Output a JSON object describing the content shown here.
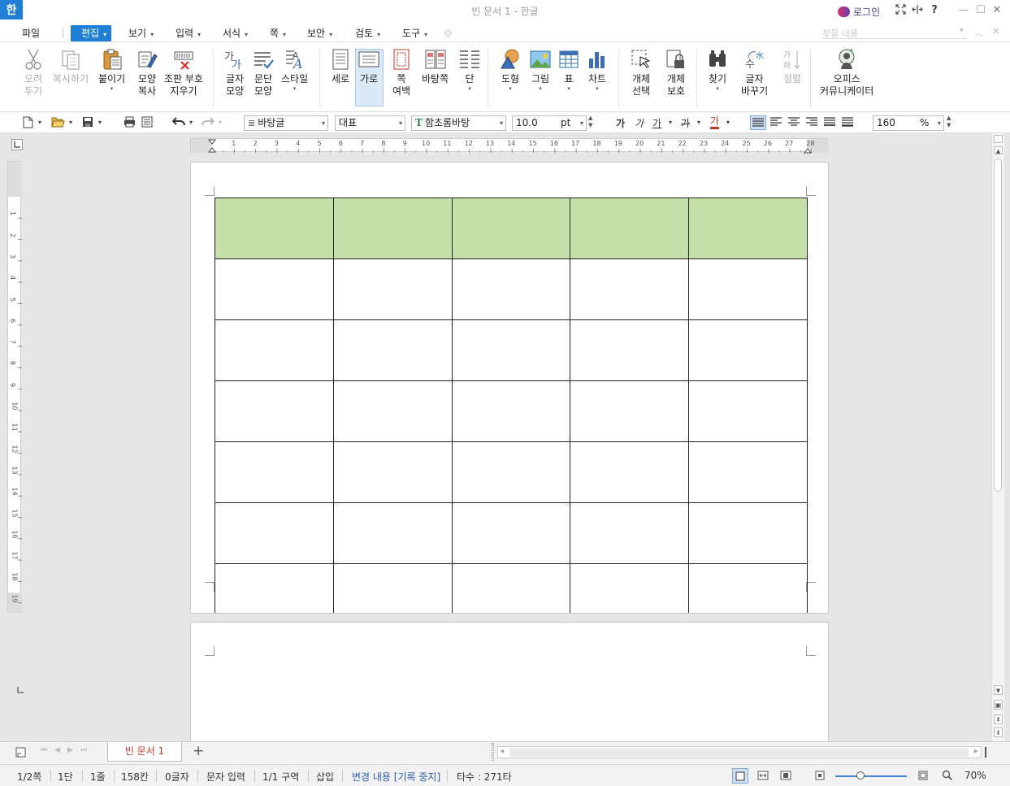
{
  "window": {
    "app_icon": "한",
    "title": "빈 문서 1 - 한글",
    "login_label": "로그인",
    "controls": [
      "fullscreen-icon",
      "split-icon",
      "help-icon",
      "minimize-icon",
      "maximize-icon",
      "close-icon"
    ],
    "help_glyph": "?",
    "minimize_glyph": "—",
    "maximize_glyph": "☐",
    "close_glyph": "✕"
  },
  "menu": {
    "items": [
      "파일",
      "편집",
      "보기",
      "입력",
      "서식",
      "쪽",
      "보안",
      "검토",
      "도구"
    ],
    "active": "편집",
    "search_placeholder": "찾을 내용"
  },
  "ribbon": {
    "cut": "오려\n두기",
    "copy": "복사하기",
    "paste": "붙이기",
    "format_copy": "모양\n복사",
    "clear_marks": "조판 부호\n지우기",
    "char_shape": "글자\n모양",
    "para_shape": "문단\n모양",
    "style": "스타일",
    "portrait": "세로",
    "landscape": "가로",
    "margins": "쪽\n여백",
    "background_page": "바탕쪽",
    "columns": "단",
    "shape": "도형",
    "picture": "그림",
    "table": "표",
    "chart": "차트",
    "select_object": "개체\n선택",
    "protect_object": "개체\n보호",
    "find": "찾기",
    "replace_chars": "글자\n바꾸기",
    "sort": "정렬",
    "office_community": "오피스\n커뮤니케이터"
  },
  "format": {
    "style_name": "바탕글",
    "lang": "대표",
    "font": "함초롬바탕",
    "size": "10.0",
    "unit": "pt",
    "zoom": "160",
    "zoom_unit": "%"
  },
  "ruler": {
    "h_ticks": [
      "1",
      "2",
      "3",
      "4",
      "5",
      "6",
      "7",
      "8",
      "9",
      "10",
      "11",
      "12",
      "13",
      "14",
      "15",
      "16",
      "17",
      "18",
      "19",
      "20",
      "21",
      "22",
      "23",
      "24",
      "25",
      "26",
      "27",
      "28"
    ],
    "v_ticks": [
      "1",
      "2",
      "3",
      "4",
      "5",
      "6",
      "7",
      "8",
      "9",
      "10",
      "11",
      "12",
      "13",
      "14",
      "15",
      "16",
      "17",
      "18",
      "19"
    ]
  },
  "table": {
    "rows": 7,
    "cols": 5,
    "header_color": "#c5e0a8"
  },
  "tabs": {
    "doc_tab": "빈 문서 1",
    "add_tab": "+"
  },
  "status": {
    "page": "1/2쪽",
    "column": "1단",
    "line": "1줄",
    "col": "158칸",
    "chars": "0글자",
    "mode": "문자 입력",
    "section": "1/1 구역",
    "insert": "삽입",
    "track_changes": "변경 내용 [기록 중지]",
    "typing_speed": "타수 : 271타",
    "zoom": "70%"
  },
  "colors": {
    "accent": "#1e7fd4",
    "tab_text": "#c0392b",
    "track_changes": "#2a5db0"
  }
}
